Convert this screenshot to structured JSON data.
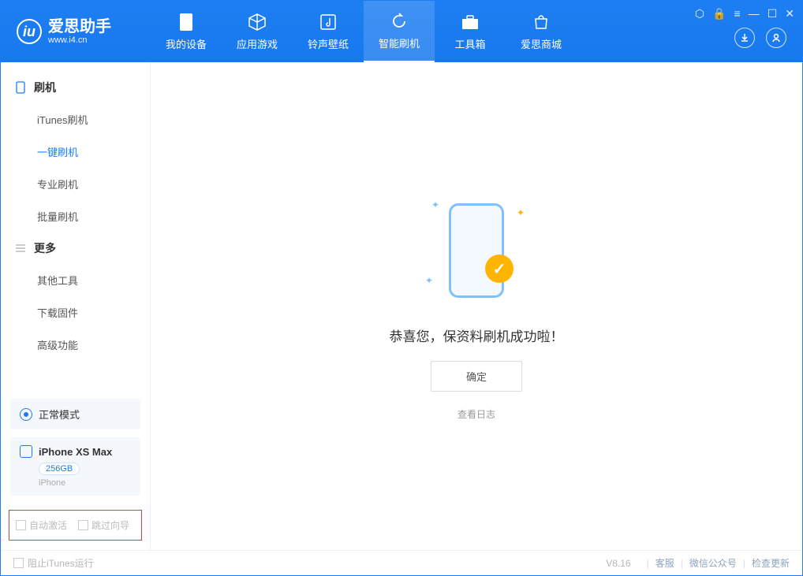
{
  "header": {
    "logo_title": "爱思助手",
    "logo_sub": "www.i4.cn",
    "nav": [
      {
        "label": "我的设备",
        "icon": "device-icon"
      },
      {
        "label": "应用游戏",
        "icon": "cube-icon"
      },
      {
        "label": "铃声壁纸",
        "icon": "music-icon"
      },
      {
        "label": "智能刷机",
        "icon": "refresh-icon",
        "active": true
      },
      {
        "label": "工具箱",
        "icon": "toolbox-icon"
      },
      {
        "label": "爱思商城",
        "icon": "shop-icon"
      }
    ]
  },
  "sidebar": {
    "groups": [
      {
        "title": "刷机",
        "items": [
          "iTunes刷机",
          "一键刷机",
          "专业刷机",
          "批量刷机"
        ],
        "active_index": 1
      },
      {
        "title": "更多",
        "items": [
          "其他工具",
          "下载固件",
          "高级功能"
        ],
        "active_index": -1
      }
    ],
    "mode_label": "正常模式",
    "device": {
      "name": "iPhone XS Max",
      "capacity": "256GB",
      "type": "iPhone"
    },
    "checks": {
      "auto_activate": "自动激活",
      "skip_guide": "跳过向导"
    }
  },
  "content": {
    "success_msg": "恭喜您，保资料刷机成功啦！",
    "ok_label": "确定",
    "log_link": "查看日志"
  },
  "footer": {
    "block_itunes": "阻止iTunes运行",
    "version": "V8.16",
    "links": [
      "客服",
      "微信公众号",
      "检查更新"
    ]
  }
}
